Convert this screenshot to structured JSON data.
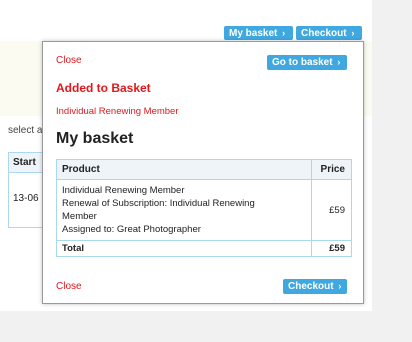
{
  "header": {
    "my_basket_label": "My basket",
    "checkout_label": "Checkout",
    "chevron": "›"
  },
  "background": {
    "select_text": "select a",
    "table_header": "Start",
    "table_cell": "13-06"
  },
  "popup": {
    "close_label": "Close",
    "go_to_basket_label": "Go to basket",
    "added_title": "Added to Basket",
    "member_name": "Individual Renewing Member",
    "basket_title": "My basket",
    "table": {
      "columns": [
        "Product",
        "Price"
      ],
      "item": {
        "lines": [
          "Individual Renewing Member",
          "Renewal of Subscription: Individual Renewing",
          "Member",
          "Assigned to: Great Photographer"
        ],
        "price": "£59"
      },
      "total_label": "Total",
      "total_value": "£59"
    },
    "close_bottom_label": "Close",
    "checkout_label": "Checkout"
  },
  "colors": {
    "accent_blue": "#40a8e0",
    "alert_red": "#e0181e",
    "table_border": "#a9d8ef"
  }
}
